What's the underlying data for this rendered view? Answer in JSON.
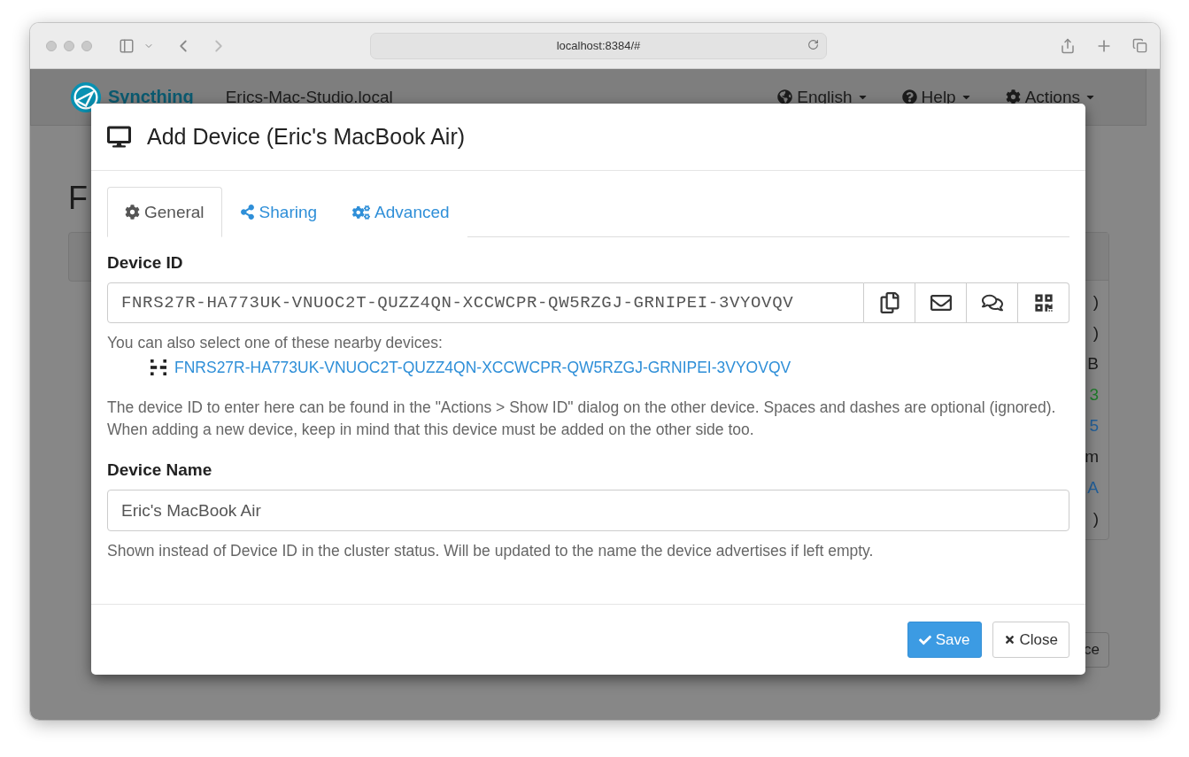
{
  "browser": {
    "url": "localhost:8384/#"
  },
  "navbar": {
    "brand": "Syncthing",
    "host": "Erics-Mac-Studio.local",
    "menus": [
      {
        "kind": "language",
        "label": "English"
      },
      {
        "kind": "help",
        "label": "Help"
      },
      {
        "kind": "actions",
        "label": "Actions"
      }
    ]
  },
  "background": {
    "heading": "F",
    "right_rows": [
      {
        "text": ")",
        "color": "#1c1c1c"
      },
      {
        "text": ")",
        "color": "#1c1c1c"
      },
      {
        "text": "B",
        "color": "#1c1c1c"
      },
      {
        "text": "3",
        "color": "#1f7a2b"
      },
      {
        "text": "5",
        "color": "#23609a"
      },
      {
        "text": "m",
        "color": "#1c1c1c"
      },
      {
        "text": "A",
        "color": "#23609a"
      },
      {
        "text": ")",
        "color": "#1c1c1c"
      }
    ],
    "button": "ce"
  },
  "dialog": {
    "title": "Add Device (Eric's MacBook Air)",
    "tabs": [
      {
        "kind": "general",
        "label": "General",
        "selected": true
      },
      {
        "kind": "sharing",
        "label": "Sharing",
        "selected": false
      },
      {
        "kind": "advanced",
        "label": "Advanced",
        "selected": false
      }
    ],
    "device_id": {
      "label": "Device ID",
      "value": "FNRS27R-HA773UK-VNUOC2T-QUZZ4QN-XCCWCPR-QW5RZGJ-GRNIPEI-3VYOVQV",
      "actions": [
        {
          "kind": "copy"
        },
        {
          "kind": "email"
        },
        {
          "kind": "chat"
        },
        {
          "kind": "qr"
        }
      ]
    },
    "nearby_hint": "You can also select one of these nearby devices:",
    "nearby_devices": [
      "FNRS27R-HA773UK-VNUOC2T-QUZZ4QN-XCCWCPR-QW5RZGJ-GRNIPEI-3VYOVQV"
    ],
    "id_help": "The device ID to enter here can be found in the \"Actions > Show ID\" dialog on the other device. Spaces and dashes are optional (ignored). When adding a new device, keep in mind that this device must be added on the other side too.",
    "device_name": {
      "label": "Device Name",
      "value": "Eric's MacBook Air"
    },
    "name_help": "Shown instead of Device ID in the cluster status. Will be updated to the name the device advertises if left empty.",
    "buttons": [
      {
        "kind": "primary",
        "label": "Save"
      },
      {
        "kind": "default",
        "label": "Close"
      }
    ]
  }
}
